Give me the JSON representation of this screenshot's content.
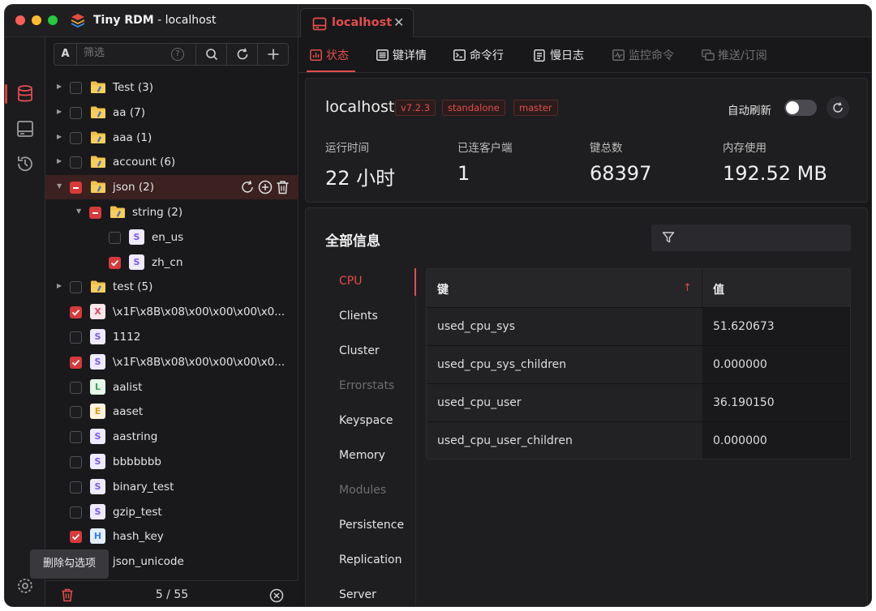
{
  "window": {
    "app_name": "Tiny RDM",
    "app_subtitle": "- localhost",
    "traffic_lights": [
      "#ff5f57",
      "#febc2e",
      "#28c840"
    ]
  },
  "connection_tab": {
    "label": "localhost",
    "close_icon": "close-icon"
  },
  "ribbon": {
    "items": [
      "database-icon",
      "terminal-icon",
      "history-icon",
      "settings-icon",
      "github-icon"
    ]
  },
  "sidebar": {
    "filter": {
      "mode_label": "A",
      "placeholder": "筛选",
      "help": "?"
    },
    "tree": [
      {
        "kind": "folder",
        "label": "Test (3)",
        "level": 0,
        "checked": "none",
        "expanded": false
      },
      {
        "kind": "folder",
        "label": "aa (7)",
        "level": 0,
        "checked": "none",
        "expanded": false
      },
      {
        "kind": "folder",
        "label": "aaa (1)",
        "level": 0,
        "checked": "none",
        "expanded": false
      },
      {
        "kind": "folder",
        "label": "account (6)",
        "level": 0,
        "checked": "none",
        "expanded": false
      },
      {
        "kind": "folder",
        "label": "json (2)",
        "level": 0,
        "checked": "partial",
        "expanded": true,
        "selected": true
      },
      {
        "kind": "folder",
        "label": "string (2)",
        "level": 1,
        "checked": "partial",
        "expanded": true
      },
      {
        "kind": "key",
        "type": "S",
        "label": "en_us",
        "level": 2,
        "checked": "none"
      },
      {
        "kind": "key",
        "type": "S",
        "label": "zh_cn",
        "level": 2,
        "checked": "checked"
      },
      {
        "kind": "folder",
        "label": "test (5)",
        "level": 0,
        "checked": "none",
        "expanded": false
      },
      {
        "kind": "key",
        "type": "X",
        "label": "\\x1F\\x8B\\x08\\x00\\x00\\x00\\x0...",
        "level": 0,
        "checked": "checked"
      },
      {
        "kind": "key",
        "type": "S",
        "label": "1112",
        "level": 0,
        "checked": "none"
      },
      {
        "kind": "key",
        "type": "S",
        "label": "\\x1F\\x8B\\x08\\x00\\x00\\x00\\x0...",
        "level": 0,
        "checked": "checked"
      },
      {
        "kind": "key",
        "type": "L",
        "label": "aalist",
        "level": 0,
        "checked": "none"
      },
      {
        "kind": "key",
        "type": "E",
        "label": "aaset",
        "level": 0,
        "checked": "none"
      },
      {
        "kind": "key",
        "type": "S",
        "label": "aastring",
        "level": 0,
        "checked": "none"
      },
      {
        "kind": "key",
        "type": "S",
        "label": "bbbbbbb",
        "level": 0,
        "checked": "none"
      },
      {
        "kind": "key",
        "type": "S",
        "label": "binary_test",
        "level": 0,
        "checked": "none"
      },
      {
        "kind": "key",
        "type": "S",
        "label": "gzip_test",
        "level": 0,
        "checked": "none"
      },
      {
        "kind": "key",
        "type": "H",
        "label": "hash_key",
        "level": 0,
        "checked": "checked"
      },
      {
        "kind": "key",
        "type": "S",
        "label": "json_unicode",
        "level": 0,
        "checked": "none"
      }
    ],
    "tooltip": "删除勾选项",
    "footer": {
      "count": "5 / 55"
    }
  },
  "subtabs": [
    {
      "label": "状态",
      "active": true,
      "icon": "status-icon"
    },
    {
      "label": "键详情",
      "active": false,
      "icon": "key-detail-icon"
    },
    {
      "label": "命令行",
      "active": false,
      "icon": "cli-icon"
    },
    {
      "label": "慢日志",
      "active": false,
      "icon": "slow-log-icon"
    },
    {
      "label": "监控命令",
      "active": false,
      "disabled": true,
      "icon": "monitor-icon"
    },
    {
      "label": "推送/订阅",
      "active": false,
      "disabled": true,
      "icon": "pubsub-icon"
    }
  ],
  "server": {
    "name": "localhost",
    "tags": [
      "v7.2.3",
      "standalone",
      "master"
    ],
    "auto_refresh_label": "自动刷新",
    "auto_refresh_on": false,
    "stats": [
      {
        "label": "运行时间",
        "value": "22 小时"
      },
      {
        "label": "已连客户端",
        "value": "1"
      },
      {
        "label": "键总数",
        "value": "68397"
      },
      {
        "label": "内存使用",
        "value": "192.52 MB"
      }
    ]
  },
  "info": {
    "title": "全部信息",
    "sections": [
      {
        "label": "CPU",
        "active": true
      },
      {
        "label": "Clients"
      },
      {
        "label": "Cluster"
      },
      {
        "label": "Errorstats",
        "disabled": true
      },
      {
        "label": "Keyspace"
      },
      {
        "label": "Memory"
      },
      {
        "label": "Modules",
        "disabled": true
      },
      {
        "label": "Persistence"
      },
      {
        "label": "Replication"
      },
      {
        "label": "Server"
      }
    ],
    "table": {
      "headers": {
        "key": "键",
        "value": "值"
      },
      "rows": [
        {
          "key": "used_cpu_sys",
          "value": "51.620673"
        },
        {
          "key": "used_cpu_sys_children",
          "value": "0.000000"
        },
        {
          "key": "used_cpu_user",
          "value": "36.190150"
        },
        {
          "key": "used_cpu_user_children",
          "value": "0.000000"
        }
      ]
    }
  },
  "colors": {
    "accent": "#e34d4d",
    "background": "#18181a",
    "panel": "#1e1e20"
  }
}
